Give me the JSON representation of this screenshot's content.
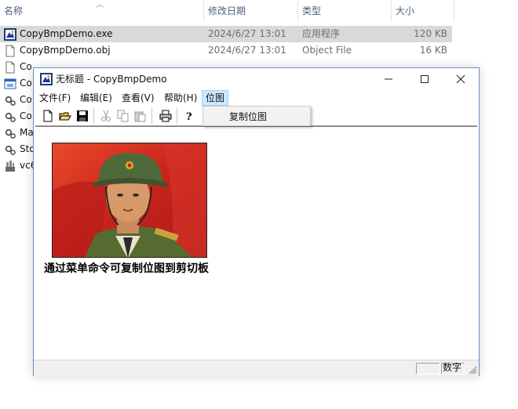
{
  "explorer": {
    "columns": {
      "name": "名称",
      "modified": "修改日期",
      "type": "类型",
      "size": "大小"
    },
    "sort_icon": "sort-up-icon",
    "files": [
      {
        "name": "CopyBmpDemo.exe",
        "date": "2024/6/27 13:01",
        "type": "应用程序",
        "size": "120 KB",
        "icon": "exe-icon",
        "selected": true
      },
      {
        "name": "CopyBmpDemo.obj",
        "date": "2024/6/27 13:01",
        "type": "Object File",
        "size": "16 KB",
        "icon": "file-icon",
        "selected": false
      },
      {
        "name": "Co",
        "date": "",
        "type": "",
        "size": "",
        "icon": "file-icon",
        "selected": false
      },
      {
        "name": "Co",
        "date": "",
        "type": "",
        "size": "",
        "icon": "app-icon",
        "selected": false
      },
      {
        "name": "Co",
        "date": "",
        "type": "",
        "size": "",
        "icon": "gear-file-icon",
        "selected": false
      },
      {
        "name": "Co",
        "date": "",
        "type": "",
        "size": "",
        "icon": "gear-file-icon",
        "selected": false
      },
      {
        "name": "Ma",
        "date": "",
        "type": "",
        "size": "",
        "icon": "gear-file-icon",
        "selected": false
      },
      {
        "name": "Sto",
        "date": "",
        "type": "",
        "size": "",
        "icon": "gear-file-icon",
        "selected": false
      },
      {
        "name": "vc6",
        "date": "",
        "type": "",
        "size": "",
        "icon": "workspace-icon",
        "selected": false
      }
    ]
  },
  "window": {
    "title": "无标题 - CopyBmpDemo",
    "menu": [
      "文件(F)",
      "编辑(E)",
      "查看(V)",
      "帮助(H)",
      "位图"
    ],
    "active_menu": "位图",
    "dropdown_items": [
      "复制位图"
    ],
    "toolbar": [
      "new-icon",
      "open-icon",
      "save-icon",
      "cut-icon",
      "copy-icon",
      "paste-icon",
      "print-icon",
      "help-icon"
    ],
    "caption": "通过菜单命令可复制位图到剪切板",
    "status": "数字",
    "accent": "#99d1ff"
  }
}
